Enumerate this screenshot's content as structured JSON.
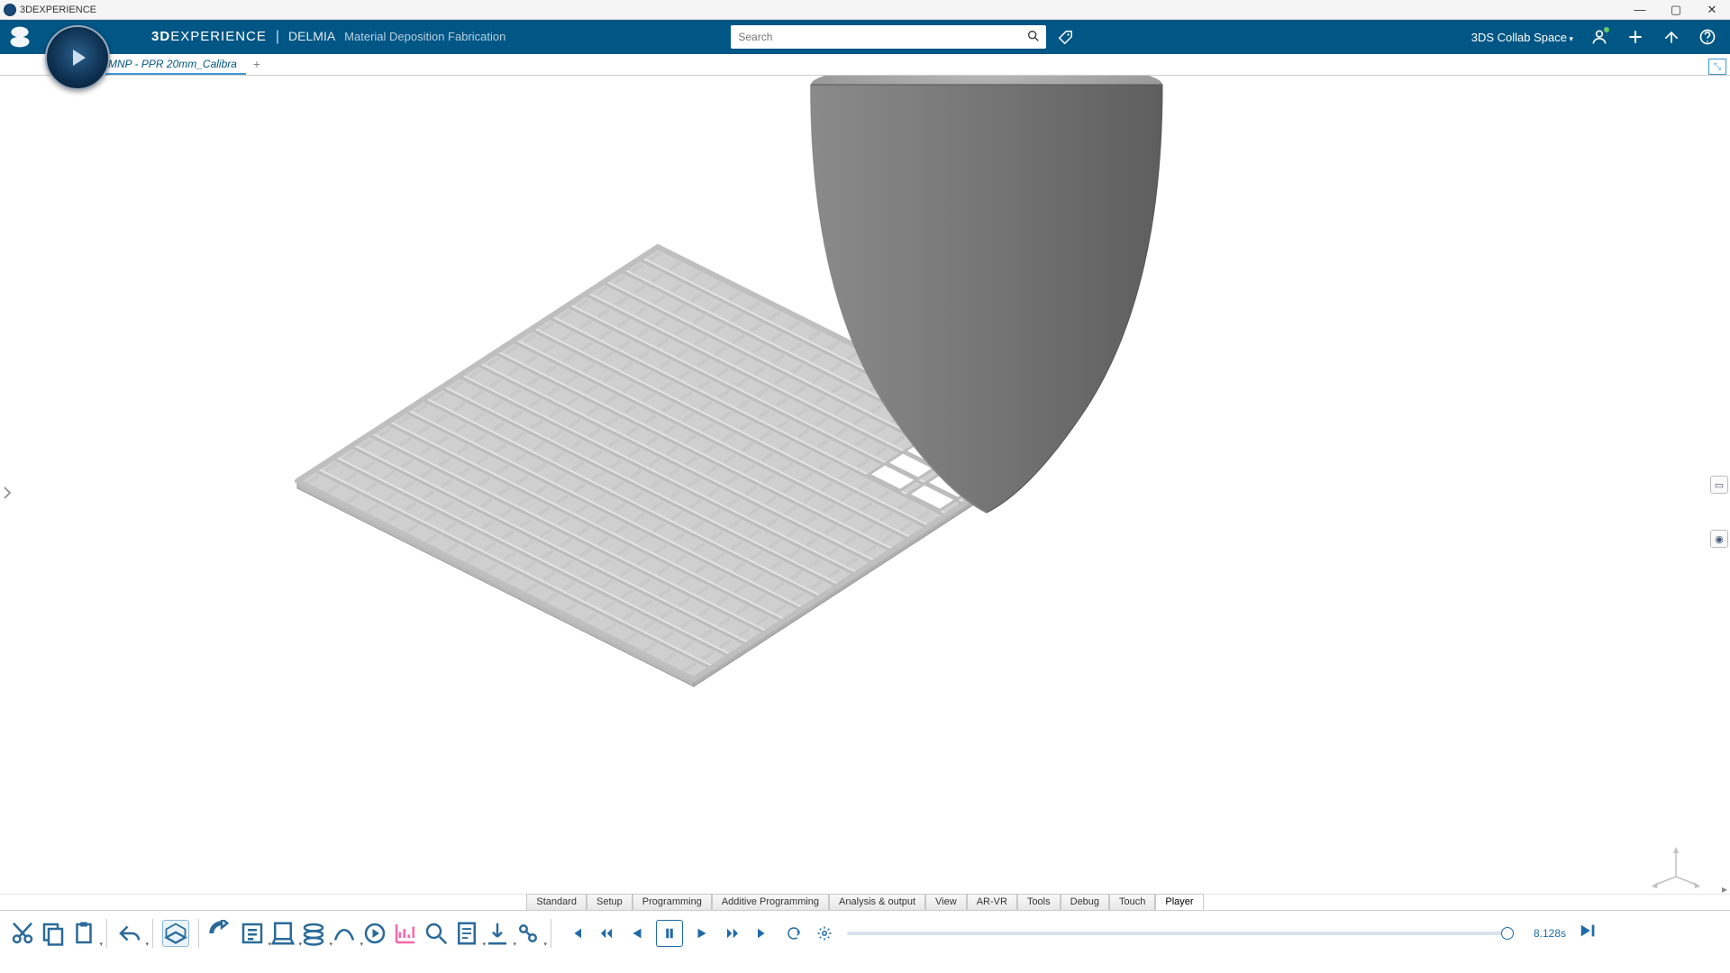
{
  "title": "3DEXPERIENCE",
  "brand": {
    "line1a": "3D",
    "line1b": "EXPERIENCE",
    "line2": "DELMIA",
    "line3": "Material Deposition Fabrication"
  },
  "search": {
    "placeholder": "Search"
  },
  "header": {
    "collab": "3DS Collab Space"
  },
  "tabs": {
    "active": "MNP - PPR 20mm_Calibra"
  },
  "bottom_tabs": [
    "Standard",
    "Setup",
    "Programming",
    "Additive Programming",
    "Analysis & output",
    "View",
    "AR-VR",
    "Tools",
    "Debug",
    "Touch",
    "Player"
  ],
  "bottom_tabs_active": "Player",
  "player": {
    "time": "8.128s"
  },
  "win": {
    "min": "—",
    "max": "▢",
    "close": "✕"
  }
}
